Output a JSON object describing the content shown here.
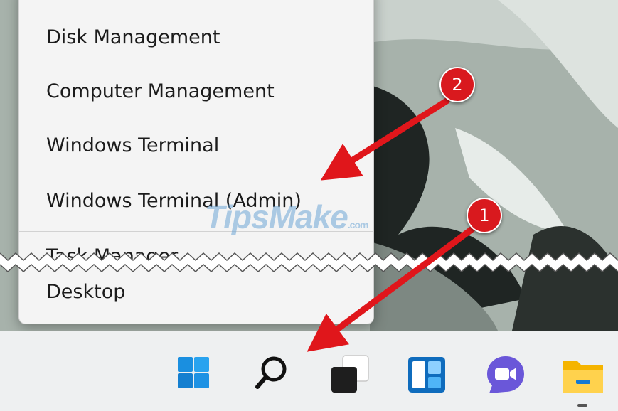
{
  "context_menu": {
    "items": [
      {
        "label": "Disk Management"
      },
      {
        "label": "Computer Management"
      },
      {
        "label": "Windows Terminal"
      },
      {
        "label": "Windows Terminal (Admin)"
      },
      {
        "label": "Task Manager"
      },
      {
        "label": "Desktop"
      }
    ]
  },
  "annotations": {
    "step_1": "1",
    "step_2": "2",
    "color": "#d9191e"
  },
  "watermark": {
    "brand": "TipsMake",
    "suffix": ".com"
  },
  "taskbar": {
    "icons": [
      "start-icon",
      "search-icon",
      "task-view-icon",
      "widgets-icon",
      "teams-chat-icon",
      "file-explorer-icon"
    ]
  }
}
